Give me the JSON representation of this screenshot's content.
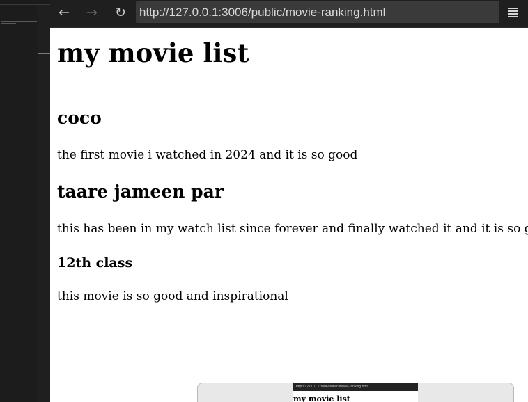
{
  "browser": {
    "nav": {
      "back_icon": "←",
      "forward_icon": "→",
      "reload_icon": "↻"
    },
    "url": "http://127.0.0.1:3006/public/movie-ranking.html"
  },
  "page": {
    "title": "my movie list",
    "movies": [
      {
        "title": "coco",
        "description": "the first movie i watched in 2024 and it is so good"
      },
      {
        "title": "taare jameen par",
        "description": "this has been in my watch list since forever and finally watched it and it is so good"
      },
      {
        "title": "12th class",
        "description": "this movie is so good and inspirational"
      }
    ]
  },
  "preview": {
    "url": "http://127.0.0.1:3006/public/movie-ranking.html",
    "title": "my movie list"
  }
}
